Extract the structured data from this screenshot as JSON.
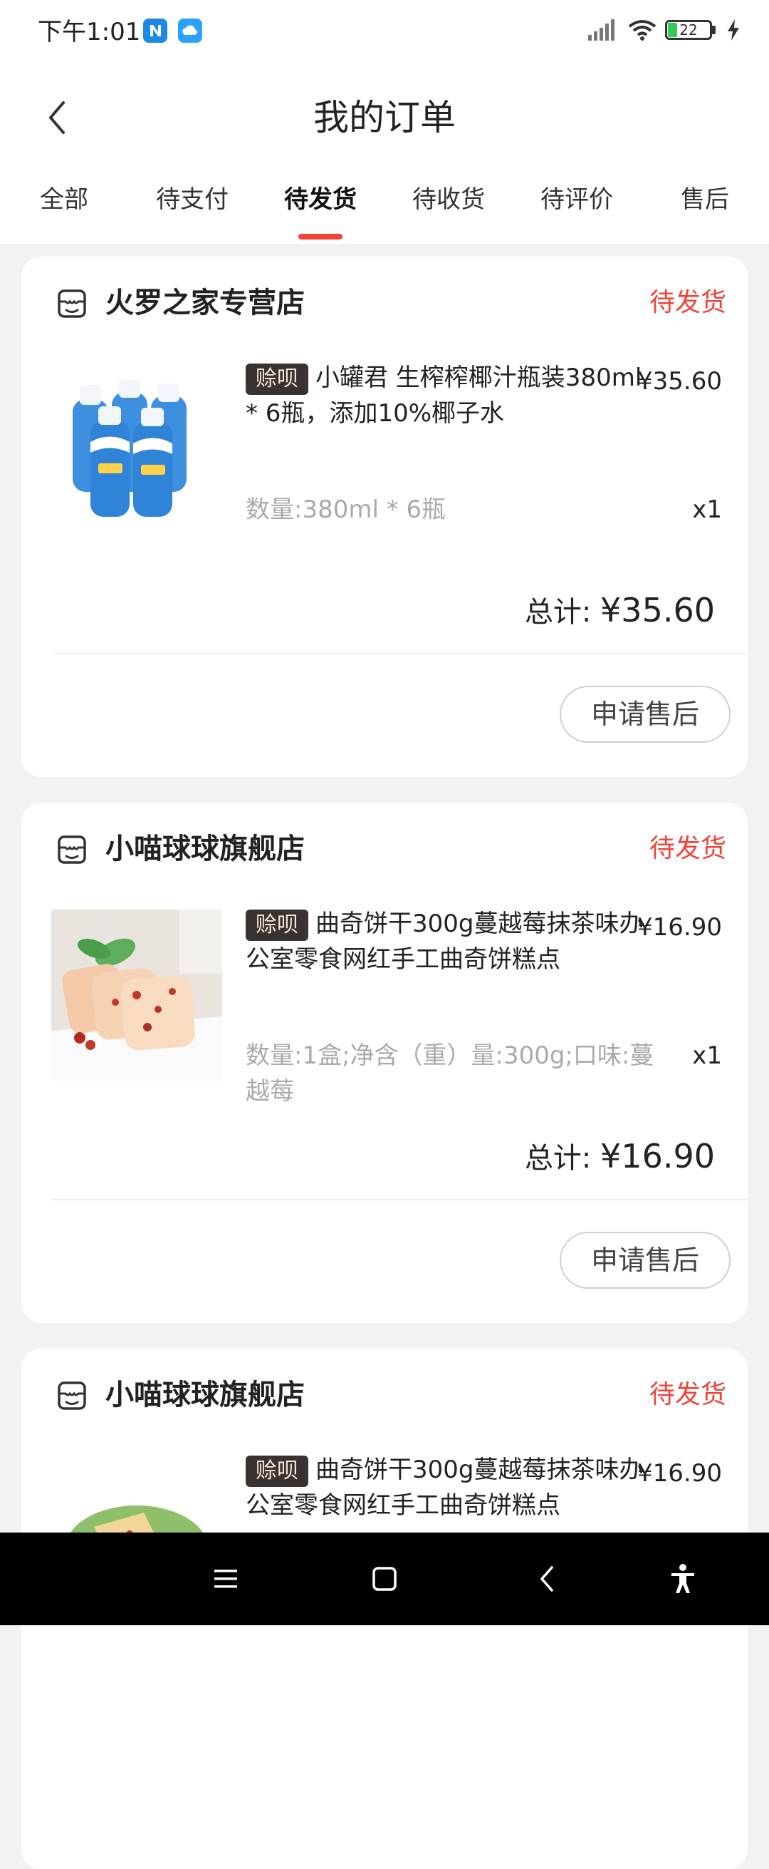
{
  "status_bar": {
    "time": "下午1:01",
    "battery_level": "22",
    "battery_fraction": 0.22,
    "icons": [
      "app-n-icon",
      "cloud-icon",
      "signal-icon",
      "wifi-icon",
      "battery-icon",
      "charging-icon"
    ]
  },
  "header": {
    "title": "我的订单",
    "back_icon": "chevron-left-icon"
  },
  "tabs": [
    {
      "label": "全部",
      "active": false
    },
    {
      "label": "待支付",
      "active": false
    },
    {
      "label": "待发货",
      "active": true
    },
    {
      "label": "待收货",
      "active": false
    },
    {
      "label": "待评价",
      "active": false
    },
    {
      "label": "售后",
      "active": false
    }
  ],
  "colors": {
    "accent": "#f04438",
    "badge_bg": "#3a3230"
  },
  "orders": [
    {
      "shop_name": "火罗之家专营店",
      "status": "待发货",
      "badge": "赊呗",
      "title": "小罐君 生榨榨椰汁瓶装380ml * 6瓶，添加10%椰子水",
      "price": "¥35.60",
      "spec": "数量:380ml * 6瓶",
      "qty": "x1",
      "total_label": "总计:",
      "total_amount": "¥35.60",
      "button": "申请售后",
      "image": "coconut-milk-bottles-image"
    },
    {
      "shop_name": "小喵球球旗舰店",
      "status": "待发货",
      "badge": "赊呗",
      "title": "曲奇饼干300g蔓越莓抹茶味办公室零食网红手工曲奇饼糕点",
      "price": "¥16.90",
      "spec": "数量:1盒;净含（重）量:300g;口味:蔓越莓",
      "qty": "x1",
      "total_label": "总计:",
      "total_amount": "¥16.90",
      "button": "申请售后",
      "image": "cranberry-cookies-image"
    },
    {
      "shop_name": "小喵球球旗舰店",
      "status": "待发货",
      "badge": "赊呗",
      "title": "曲奇饼干300g蔓越莓抹茶味办公室零食网红手工曲奇饼糕点",
      "price": "¥16.90",
      "spec": "",
      "qty": "",
      "total_label": "",
      "total_amount": "",
      "button": "",
      "image": "matcha-cookies-image"
    }
  ],
  "nav_bar": {
    "icons": [
      "menu-icon",
      "home-square-icon",
      "back-triangle-icon",
      "accessibility-icon"
    ]
  }
}
